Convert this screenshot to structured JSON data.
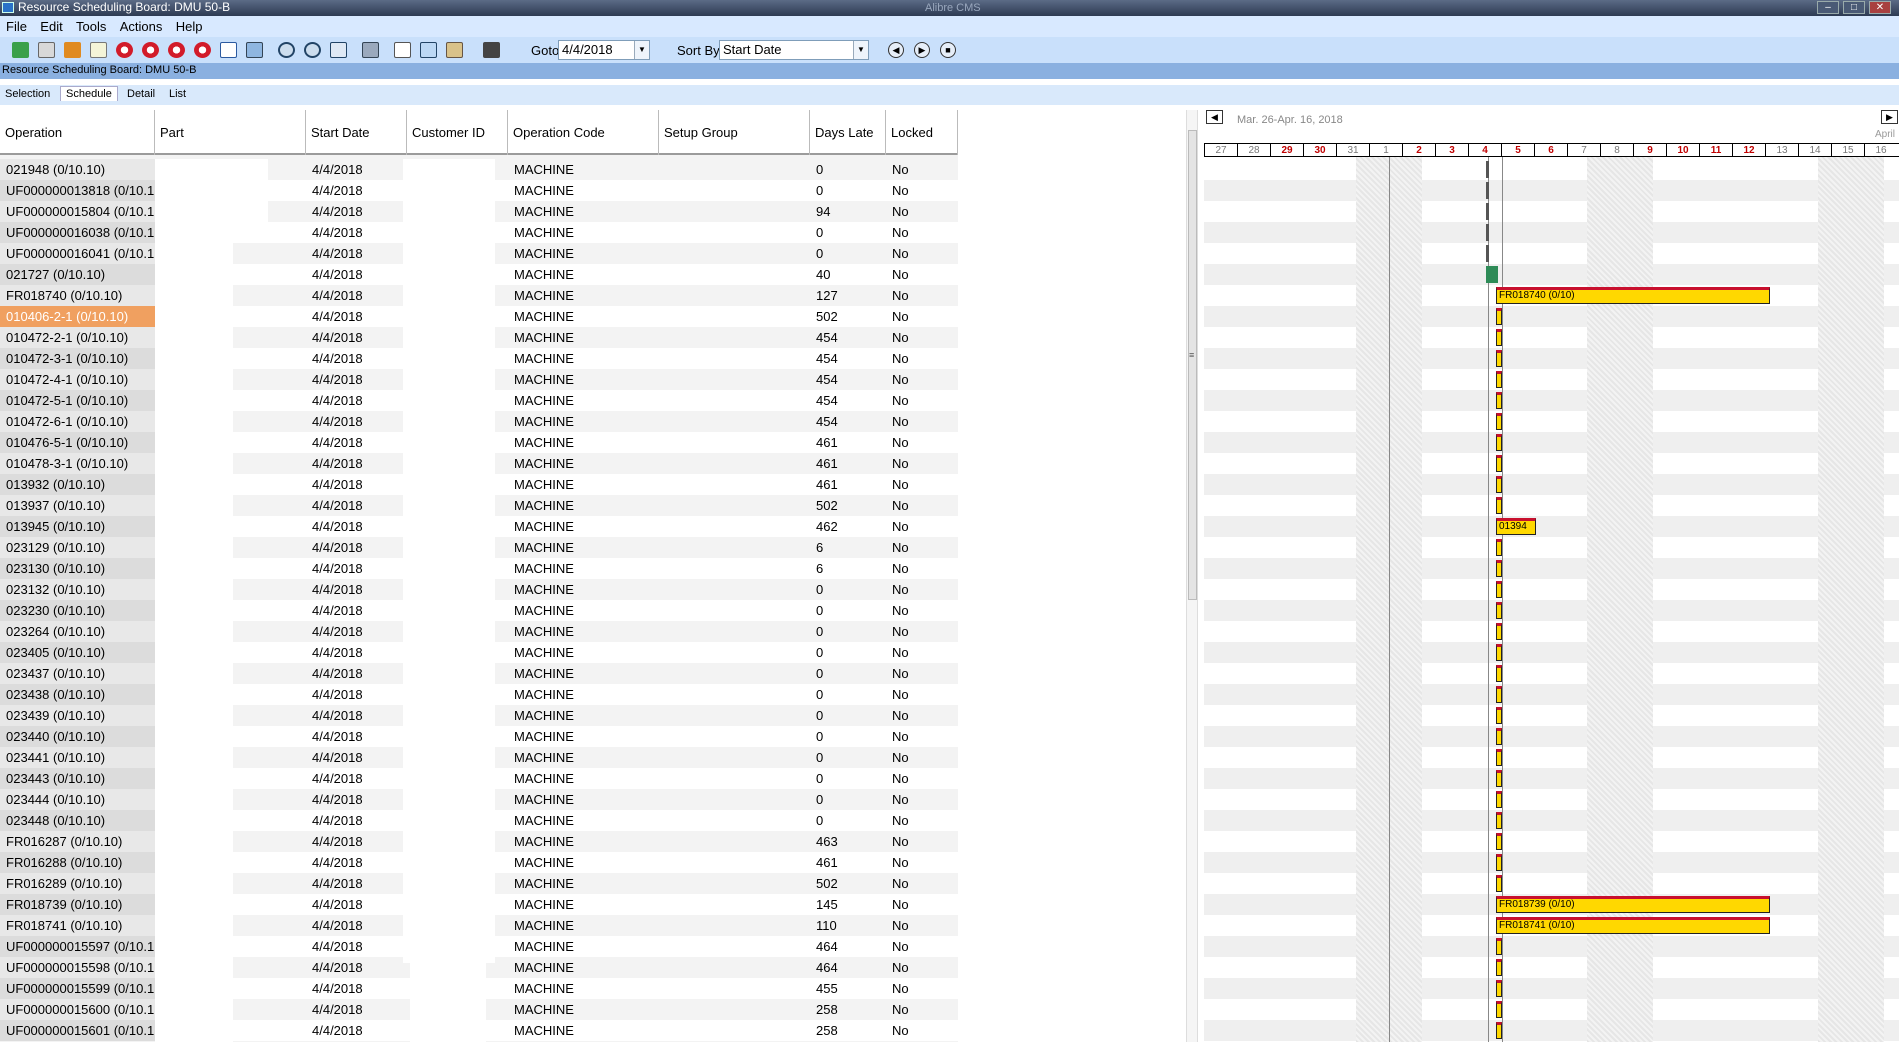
{
  "window": {
    "title": "Resource Scheduling Board: DMU 50-B",
    "background_title": "Alibre CMS"
  },
  "menu": [
    "File",
    "Edit",
    "Tools",
    "Actions",
    "Help"
  ],
  "toolbar": {
    "goto_label": "Goto",
    "goto_value": "4/4/2018",
    "sortby_label": "Sort By",
    "sortby_value": "Start Date",
    "icons": [
      "refresh-icon",
      "eraser-icon",
      "schedule-icon",
      "document-icon",
      "lifebuoy-icon",
      "lifebuoy-icon",
      "lifebuoy-icon",
      "lifebuoy-icon",
      "calendar-icon",
      "image-icon",
      "zoom-in-icon",
      "zoom-out-icon",
      "fit-icon",
      "print-icon",
      "cut-icon",
      "copy-icon",
      "paste-icon",
      "find-icon"
    ],
    "nav_icons": [
      "back-icon",
      "forward-icon",
      "stop-icon"
    ]
  },
  "subtitle": "Resource Scheduling Board: DMU 50-B",
  "tabs": [
    "Selection",
    "Schedule",
    "Detail",
    "List"
  ],
  "active_tab": "Schedule",
  "table": {
    "columns": [
      "Operation",
      "Part",
      "Start Date",
      "Customer ID",
      "Operation Code",
      "Setup Group",
      "Days Late",
      "Locked"
    ],
    "selected_row": 7,
    "rows": [
      [
        "021948 (0/10.10)",
        "",
        "4/4/2018",
        "",
        "MACHINE",
        "",
        "0",
        "No"
      ],
      [
        "UF000000013818 (0/10.1",
        "",
        "4/4/2018",
        "",
        "MACHINE",
        "",
        "0",
        "No"
      ],
      [
        "UF000000015804 (0/10.1",
        "",
        "4/4/2018",
        "",
        "MACHINE",
        "",
        "94",
        "No"
      ],
      [
        "UF000000016038 (0/10.1",
        "",
        "4/4/2018",
        "",
        "MACHINE",
        "",
        "0",
        "No"
      ],
      [
        "UF000000016041 (0/10.1",
        "",
        "4/4/2018",
        "",
        "MACHINE",
        "",
        "0",
        "No"
      ],
      [
        "021727 (0/10.10)",
        "",
        "4/4/2018",
        "",
        "MACHINE",
        "",
        "40",
        "No"
      ],
      [
        "FR018740 (0/10.10)",
        "",
        "4/4/2018",
        "",
        "MACHINE",
        "",
        "127",
        "No"
      ],
      [
        "010406-2-1 (0/10.10)",
        "",
        "4/4/2018",
        "",
        "MACHINE",
        "",
        "502",
        "No"
      ],
      [
        "010472-2-1 (0/10.10)",
        "",
        "4/4/2018",
        "",
        "MACHINE",
        "",
        "454",
        "No"
      ],
      [
        "010472-3-1 (0/10.10)",
        "",
        "4/4/2018",
        "",
        "MACHINE",
        "",
        "454",
        "No"
      ],
      [
        "010472-4-1 (0/10.10)",
        "",
        "4/4/2018",
        "",
        "MACHINE",
        "",
        "454",
        "No"
      ],
      [
        "010472-5-1 (0/10.10)",
        "",
        "4/4/2018",
        "",
        "MACHINE",
        "",
        "454",
        "No"
      ],
      [
        "010472-6-1 (0/10.10)",
        "",
        "4/4/2018",
        "",
        "MACHINE",
        "",
        "454",
        "No"
      ],
      [
        "010476-5-1 (0/10.10)",
        "",
        "4/4/2018",
        "",
        "MACHINE",
        "",
        "461",
        "No"
      ],
      [
        "010478-3-1 (0/10.10)",
        "",
        "4/4/2018",
        "",
        "MACHINE",
        "",
        "461",
        "No"
      ],
      [
        "013932 (0/10.10)",
        "",
        "4/4/2018",
        "",
        "MACHINE",
        "",
        "461",
        "No"
      ],
      [
        "013937 (0/10.10)",
        "",
        "4/4/2018",
        "",
        "MACHINE",
        "",
        "502",
        "No"
      ],
      [
        "013945 (0/10.10)",
        "",
        "4/4/2018",
        "",
        "MACHINE",
        "",
        "462",
        "No"
      ],
      [
        "023129 (0/10.10)",
        "",
        "4/4/2018",
        "",
        "MACHINE",
        "",
        "6",
        "No"
      ],
      [
        "023130 (0/10.10)",
        "",
        "4/4/2018",
        "",
        "MACHINE",
        "",
        "6",
        "No"
      ],
      [
        "023132 (0/10.10)",
        "",
        "4/4/2018",
        "",
        "MACHINE",
        "",
        "0",
        "No"
      ],
      [
        "023230 (0/10.10)",
        "",
        "4/4/2018",
        "",
        "MACHINE",
        "",
        "0",
        "No"
      ],
      [
        "023264 (0/10.10)",
        "",
        "4/4/2018",
        "",
        "MACHINE",
        "",
        "0",
        "No"
      ],
      [
        "023405 (0/10.10)",
        "",
        "4/4/2018",
        "",
        "MACHINE",
        "",
        "0",
        "No"
      ],
      [
        "023437 (0/10.10)",
        "",
        "4/4/2018",
        "",
        "MACHINE",
        "",
        "0",
        "No"
      ],
      [
        "023438 (0/10.10)",
        "",
        "4/4/2018",
        "",
        "MACHINE",
        "",
        "0",
        "No"
      ],
      [
        "023439 (0/10.10)",
        "",
        "4/4/2018",
        "",
        "MACHINE",
        "",
        "0",
        "No"
      ],
      [
        "023440 (0/10.10)",
        "",
        "4/4/2018",
        "",
        "MACHINE",
        "",
        "0",
        "No"
      ],
      [
        "023441 (0/10.10)",
        "",
        "4/4/2018",
        "",
        "MACHINE",
        "",
        "0",
        "No"
      ],
      [
        "023443 (0/10.10)",
        "",
        "4/4/2018",
        "",
        "MACHINE",
        "",
        "0",
        "No"
      ],
      [
        "023444 (0/10.10)",
        "",
        "4/4/2018",
        "",
        "MACHINE",
        "",
        "0",
        "No"
      ],
      [
        "023448 (0/10.10)",
        "",
        "4/4/2018",
        "",
        "MACHINE",
        "",
        "0",
        "No"
      ],
      [
        "FR016287 (0/10.10)",
        "",
        "4/4/2018",
        "",
        "MACHINE",
        "",
        "463",
        "No"
      ],
      [
        "FR016288 (0/10.10)",
        "",
        "4/4/2018",
        "",
        "MACHINE",
        "",
        "461",
        "No"
      ],
      [
        "FR016289 (0/10.10)",
        "",
        "4/4/2018",
        "",
        "MACHINE",
        "",
        "502",
        "No"
      ],
      [
        "FR018739 (0/10.10)",
        "",
        "4/4/2018",
        "",
        "MACHINE",
        "",
        "145",
        "No"
      ],
      [
        "FR018741 (0/10.10)",
        "",
        "4/4/2018",
        "",
        "MACHINE",
        "",
        "110",
        "No"
      ],
      [
        "UF000000015597 (0/10.1",
        "",
        "4/4/2018",
        "",
        "MACHINE",
        "",
        "464",
        "No"
      ],
      [
        "UF000000015598 (0/10.1",
        "",
        "4/4/2018",
        "",
        "MACHINE",
        "",
        "464",
        "No"
      ],
      [
        "UF000000015599 (0/10.1",
        "",
        "4/4/2018",
        "",
        "MACHINE",
        "",
        "455",
        "No"
      ],
      [
        "UF000000015600 (0/10.1",
        "",
        "4/4/2018",
        "",
        "MACHINE",
        "",
        "258",
        "No"
      ],
      [
        "UF000000015601 (0/10.1",
        "",
        "4/4/2018",
        "",
        "MACHINE",
        "",
        "258",
        "No"
      ]
    ]
  },
  "gantt": {
    "range_label": "Mar. 26-Apr. 16, 2018",
    "month_label": "April",
    "days": [
      {
        "label": "27",
        "red": false
      },
      {
        "label": "28",
        "red": false
      },
      {
        "label": "29",
        "red": true
      },
      {
        "label": "30",
        "red": true
      },
      {
        "label": "31",
        "red": false
      },
      {
        "label": "1",
        "red": false
      },
      {
        "label": "2",
        "red": true
      },
      {
        "label": "3",
        "red": true
      },
      {
        "label": "4",
        "red": true
      },
      {
        "label": "5",
        "red": true
      },
      {
        "label": "6",
        "red": true
      },
      {
        "label": "7",
        "red": false
      },
      {
        "label": "8",
        "red": false
      },
      {
        "label": "9",
        "red": true
      },
      {
        "label": "10",
        "red": true
      },
      {
        "label": "11",
        "red": true
      },
      {
        "label": "12",
        "red": true
      },
      {
        "label": "13",
        "red": false
      },
      {
        "label": "14",
        "red": false
      },
      {
        "label": "15",
        "red": false
      },
      {
        "label": "16",
        "red": false
      }
    ],
    "bars": [
      {
        "row": 6,
        "label": "FR018740 (0/10)"
      },
      {
        "row": 17,
        "label": "01394"
      },
      {
        "row": 35,
        "label": "FR018739 (0/10)"
      },
      {
        "row": 36,
        "label": "FR018741 (0/10)"
      }
    ],
    "bar_colors": {
      "fill": "#ffd800",
      "top": "#c8102e",
      "today_marker": "#2e8b57"
    }
  }
}
